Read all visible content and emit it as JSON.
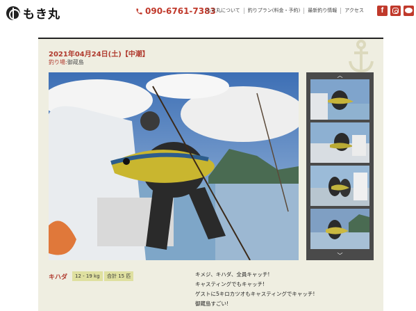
{
  "header": {
    "logo_text": "もき丸",
    "phone": "090-6761-7383",
    "nav": [
      "もき丸について",
      "釣りプラン(料金・予約)",
      "最新釣り情報",
      "アクセス"
    ],
    "social": [
      {
        "name": "facebook",
        "glyph": "f"
      },
      {
        "name": "instagram",
        "glyph": ""
      },
      {
        "name": "line",
        "glyph": ""
      }
    ]
  },
  "report": {
    "date_title": "2021年04月24日(土)【中潮】",
    "spot_label": "釣り場:",
    "spot_value": "御蔵島",
    "thumb_up": "︿",
    "thumb_down": "﹀"
  },
  "catch": {
    "fish": "キハダ",
    "size": "12 - 19 kg",
    "total": "合計 15 匹",
    "comment_lines": [
      "キメジ、キハダ、全員キャッチ!",
      "キャスティングでもキャッチ!",
      "ゲストに5キロカツオもキャスティングでキャッチ!",
      "御蔵島すごい!"
    ]
  },
  "colors": {
    "accent": "#c0392b",
    "panel": "#efeee1",
    "tag": "#dfe0a0"
  }
}
